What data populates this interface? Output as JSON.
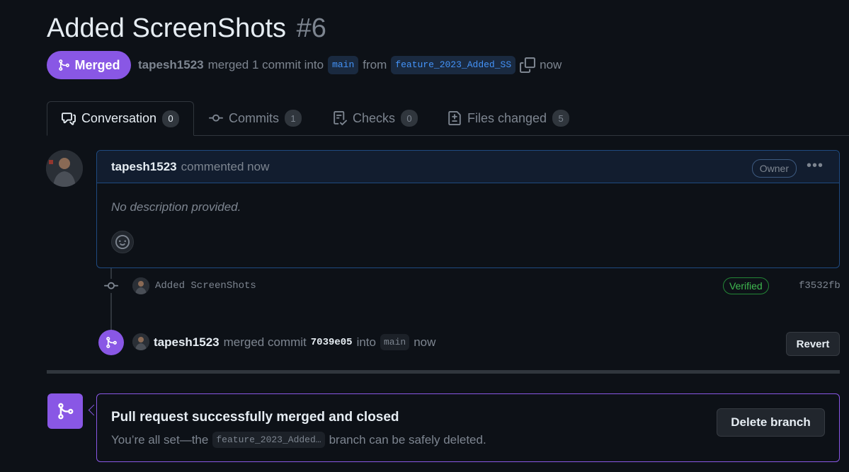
{
  "pr": {
    "title": "Added ScreenShots",
    "number": "#6",
    "state": "Merged",
    "author": "tapesh1523",
    "merge_summary": "merged 1 commit into",
    "base_branch": "main",
    "from_text": "from",
    "head_branch": "feature_2023_Added_SS",
    "time": "now"
  },
  "tabs": [
    {
      "label": "Conversation",
      "count": "0",
      "icon": "comment-discussion-icon"
    },
    {
      "label": "Commits",
      "count": "1",
      "icon": "git-commit-icon"
    },
    {
      "label": "Checks",
      "count": "0",
      "icon": "checklist-icon"
    },
    {
      "label": "Files changed",
      "count": "5",
      "icon": "file-diff-icon"
    }
  ],
  "comment": {
    "author": "tapesh1523",
    "action": "commented now",
    "badge": "Owner",
    "body": "No description provided."
  },
  "commit": {
    "message": "Added ScreenShots",
    "status": "Verified",
    "sha": "f3532fb"
  },
  "merge_event": {
    "author": "tapesh1523",
    "action": "merged commit",
    "sha": "7039e05",
    "into_text": "into",
    "branch": "main",
    "time": "now",
    "revert_label": "Revert"
  },
  "merged_box": {
    "title": "Pull request successfully merged and closed",
    "sub_prefix": "You’re all set—the",
    "branch": "feature_2023_Added…",
    "sub_suffix": "branch can be safely deleted.",
    "delete_label": "Delete branch"
  },
  "colors": {
    "background": "#0d1117",
    "merged_purple": "#8957e5",
    "link_blue": "#4493f8",
    "verified_green": "#3fb950",
    "muted": "#7d8590"
  }
}
